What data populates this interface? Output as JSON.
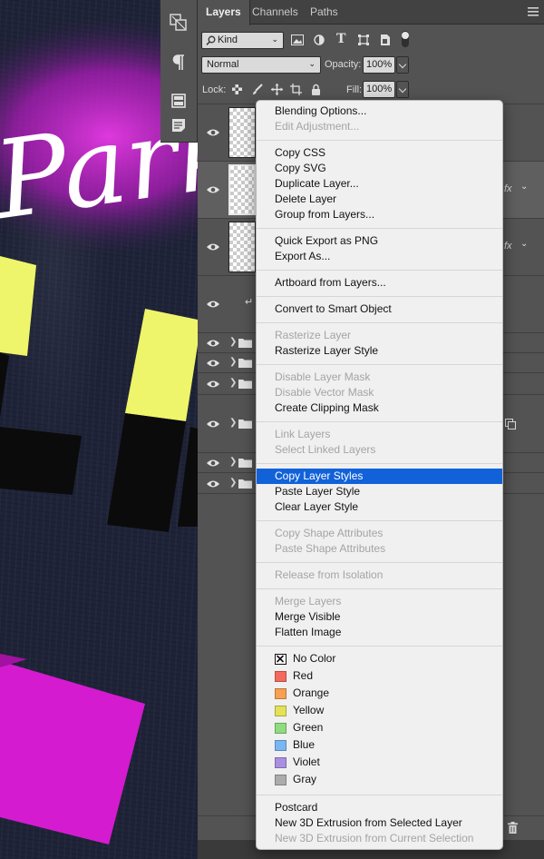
{
  "canvas": {
    "artwork_text": "Parke",
    "colors": {
      "magenta": "#d41bd0",
      "yellow": "#eff56a",
      "black": "#0b0b0b",
      "background": "#1f2338"
    }
  },
  "toolbar": {
    "icons": [
      "layer-comps-icon",
      "paragraph-icon",
      "properties-icon",
      "notes-icon"
    ]
  },
  "panel": {
    "tabs": [
      "Layers",
      "Channels",
      "Paths"
    ],
    "filter": {
      "label": "Kind",
      "icons": [
        "image-filter-icon",
        "adjustment-filter-icon",
        "type-filter-icon",
        "shape-filter-icon",
        "smart-object-filter-icon",
        "filter-toggle-icon"
      ]
    },
    "blend_mode": "Normal",
    "opacity_label": "Opacity:",
    "opacity_value": "100%",
    "lock_label": "Lock:",
    "fill_label": "Fill:",
    "fill_value": "100%",
    "fx_label": "fx"
  },
  "menu": {
    "sections": [
      {
        "items": [
          {
            "label": "Blending Options...",
            "enabled": true
          },
          {
            "label": "Edit Adjustment...",
            "enabled": false
          }
        ]
      },
      {
        "items": [
          {
            "label": "Copy CSS",
            "enabled": true
          },
          {
            "label": "Copy SVG",
            "enabled": true
          },
          {
            "label": "Duplicate Layer...",
            "enabled": true
          },
          {
            "label": "Delete Layer",
            "enabled": true
          },
          {
            "label": "Group from Layers...",
            "enabled": true
          }
        ]
      },
      {
        "items": [
          {
            "label": "Quick Export as PNG",
            "enabled": true
          },
          {
            "label": "Export As...",
            "enabled": true
          }
        ]
      },
      {
        "items": [
          {
            "label": "Artboard from Layers...",
            "enabled": true
          }
        ]
      },
      {
        "items": [
          {
            "label": "Convert to Smart Object",
            "enabled": true
          }
        ]
      },
      {
        "items": [
          {
            "label": "Rasterize Layer",
            "enabled": false
          },
          {
            "label": "Rasterize Layer Style",
            "enabled": true
          }
        ]
      },
      {
        "items": [
          {
            "label": "Disable Layer Mask",
            "enabled": false
          },
          {
            "label": "Disable Vector Mask",
            "enabled": false
          },
          {
            "label": "Create Clipping Mask",
            "enabled": true
          }
        ]
      },
      {
        "items": [
          {
            "label": "Link Layers",
            "enabled": false
          },
          {
            "label": "Select Linked Layers",
            "enabled": false
          }
        ]
      },
      {
        "items": [
          {
            "label": "Copy Layer Styles",
            "enabled": true,
            "highlighted": true
          },
          {
            "label": "Paste Layer Style",
            "enabled": true
          },
          {
            "label": "Clear Layer Style",
            "enabled": true
          }
        ]
      },
      {
        "items": [
          {
            "label": "Copy Shape Attributes",
            "enabled": false
          },
          {
            "label": "Paste Shape Attributes",
            "enabled": false
          }
        ]
      },
      {
        "items": [
          {
            "label": "Release from Isolation",
            "enabled": false
          }
        ]
      },
      {
        "items": [
          {
            "label": "Merge Layers",
            "enabled": false
          },
          {
            "label": "Merge Visible",
            "enabled": true
          },
          {
            "label": "Flatten Image",
            "enabled": true
          }
        ]
      },
      {
        "items": [
          {
            "label": "No Color",
            "enabled": true,
            "swatch": "none"
          },
          {
            "label": "Red",
            "enabled": true,
            "swatch": "#f4685e"
          },
          {
            "label": "Orange",
            "enabled": true,
            "swatch": "#f7a053"
          },
          {
            "label": "Yellow",
            "enabled": true,
            "swatch": "#e3e157"
          },
          {
            "label": "Green",
            "enabled": true,
            "swatch": "#8fdc7f"
          },
          {
            "label": "Blue",
            "enabled": true,
            "swatch": "#7bb6f4"
          },
          {
            "label": "Violet",
            "enabled": true,
            "swatch": "#a98fe0"
          },
          {
            "label": "Gray",
            "enabled": true,
            "swatch": "#acacac"
          }
        ]
      },
      {
        "items": [
          {
            "label": "Postcard",
            "enabled": true
          },
          {
            "label": "New 3D Extrusion from Selected Layer",
            "enabled": true
          },
          {
            "label": "New 3D Extrusion from Current Selection",
            "enabled": false
          }
        ]
      }
    ]
  }
}
